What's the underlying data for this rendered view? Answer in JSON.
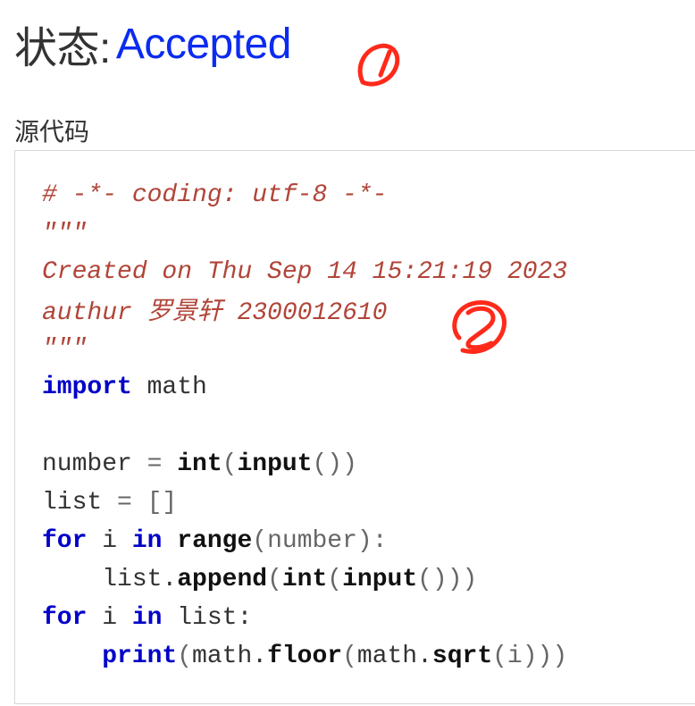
{
  "status": {
    "label": "状态: ",
    "value": "Accepted"
  },
  "section": {
    "title": "源代码"
  },
  "code": {
    "comment_coding": "# -*- coding: utf-8 -*-",
    "comment_quote_open": "\"\"\"",
    "comment_created": "Created on Thu Sep 14 15:21:19 2023",
    "comment_author_prefix": "authur ",
    "comment_author_name": "罗景轩",
    "comment_author_id": " 2300012610",
    "comment_quote_close": "\"\"\"",
    "kw_import": "import",
    "mod_math": " math",
    "var_number": "number",
    "op_assign": " = ",
    "fn_int": "int",
    "paren_open": "(",
    "fn_input": "input",
    "parens_empty": "()",
    "paren_close": ")",
    "var_list": "list",
    "list_literal": " = []",
    "kw_for": "for",
    "var_i": " i ",
    "kw_in": "in",
    "space": " ",
    "fn_range": "range",
    "range_args": "(number):",
    "indent": "    ",
    "list_dot": "list.",
    "fn_append": "append",
    "tail_append": "()))",
    "list_colon": " list:",
    "fn_print": "print",
    "math_dot": "math.",
    "fn_floor": "floor",
    "fn_sqrt": "sqrt",
    "tail_print": "(i)))"
  },
  "annotations": {
    "mark_1_color": "#ff2a1a",
    "mark_2_color": "#ff2a1a"
  }
}
